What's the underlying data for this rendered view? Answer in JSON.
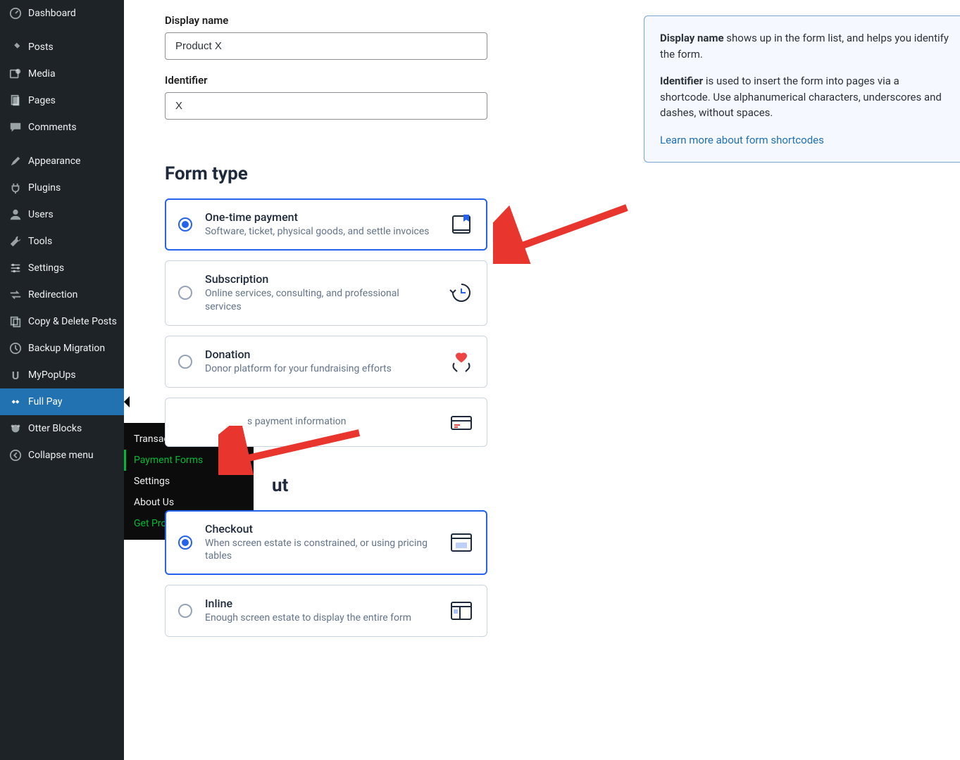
{
  "sidebar": {
    "items": [
      {
        "label": "Dashboard",
        "icon": "dashboard"
      },
      {
        "label": "Posts",
        "icon": "pin"
      },
      {
        "label": "Media",
        "icon": "media"
      },
      {
        "label": "Pages",
        "icon": "pages"
      },
      {
        "label": "Comments",
        "icon": "comment"
      },
      {
        "label": "Appearance",
        "icon": "brush"
      },
      {
        "label": "Plugins",
        "icon": "plug"
      },
      {
        "label": "Users",
        "icon": "user"
      },
      {
        "label": "Tools",
        "icon": "wrench"
      },
      {
        "label": "Settings",
        "icon": "sliders"
      },
      {
        "label": "Redirection",
        "icon": "arrows"
      },
      {
        "label": "Copy & Delete Posts",
        "icon": "copy"
      },
      {
        "label": "Backup Migration",
        "icon": "backup"
      },
      {
        "label": "MyPopUps",
        "icon": "popup"
      },
      {
        "label": "Full Pay",
        "icon": "fullpay",
        "active": true
      },
      {
        "label": "Otter Blocks",
        "icon": "otter"
      },
      {
        "label": "Collapse menu",
        "icon": "collapse"
      }
    ]
  },
  "flyout": {
    "items": [
      {
        "label": "Transactions"
      },
      {
        "label": "Payment Forms",
        "active": true
      },
      {
        "label": "Settings"
      },
      {
        "label": "About Us"
      },
      {
        "label": "Get Pro Version",
        "green": true
      }
    ]
  },
  "form": {
    "display_name_label": "Display name",
    "display_name_value": "Product X",
    "identifier_label": "Identifier",
    "identifier_value": "X"
  },
  "info": {
    "display_name_bold": "Display name",
    "display_name_rest": " shows up in the form list, and helps you identify the form.",
    "identifier_bold": "Identifier",
    "identifier_rest": " is used to insert the form into pages via a shortcode. Use alphanumerical characters, underscores and dashes, without spaces.",
    "link_text": "Learn more about form shortcodes"
  },
  "sections": {
    "form_type": {
      "heading": "Form type",
      "options": [
        {
          "title": "One-time payment",
          "desc": "Software, ticket, physical goods, and settle invoices",
          "selected": true,
          "icon": "book"
        },
        {
          "title": "Subscription",
          "desc": "Online services, consulting, and professional services",
          "selected": false,
          "icon": "clock"
        },
        {
          "title": "Donation",
          "desc": "Donor platform for your fundraising efforts",
          "selected": false,
          "icon": "heart"
        },
        {
          "title": "",
          "desc": "s payment information",
          "selected": false,
          "icon": "card",
          "obscured": true
        }
      ]
    },
    "layout": {
      "heading_partial": "ut",
      "options": [
        {
          "title": "Checkout",
          "desc": "When screen estate is constrained, or using pricing tables",
          "selected": true,
          "icon": "checkout"
        },
        {
          "title": "Inline",
          "desc": "Enough screen estate to display the entire form",
          "selected": false,
          "icon": "inline"
        }
      ]
    }
  }
}
